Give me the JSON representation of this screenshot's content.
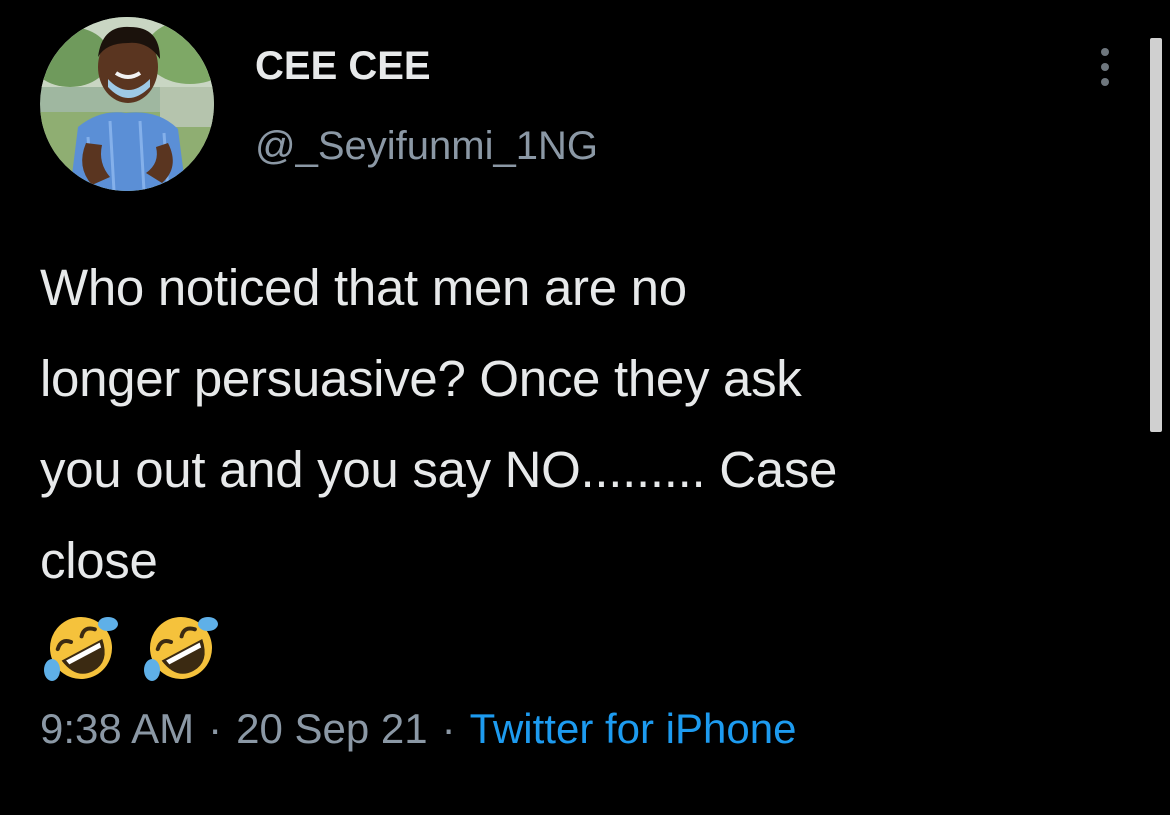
{
  "tweet": {
    "author": {
      "display_name": "CEE CEE",
      "handle": "@_Seyifunmi_1NG",
      "avatar_icon": "profile-photo"
    },
    "text": "Who noticed that men are no\nlonger persuasive? Once they ask\nyou out and you say NO......... Case\nclose",
    "emojis": [
      "rolling-on-the-floor-laughing",
      "rolling-on-the-floor-laughing"
    ],
    "time": "9:38 AM",
    "separator": "·",
    "date": "20 Sep 21",
    "source": "Twitter for iPhone",
    "more_icon": "vertical-ellipsis"
  },
  "colors": {
    "background": "#000000",
    "primary_text": "#e7e9ea",
    "secondary_text": "#8b98a5",
    "link": "#1d9bf0"
  }
}
